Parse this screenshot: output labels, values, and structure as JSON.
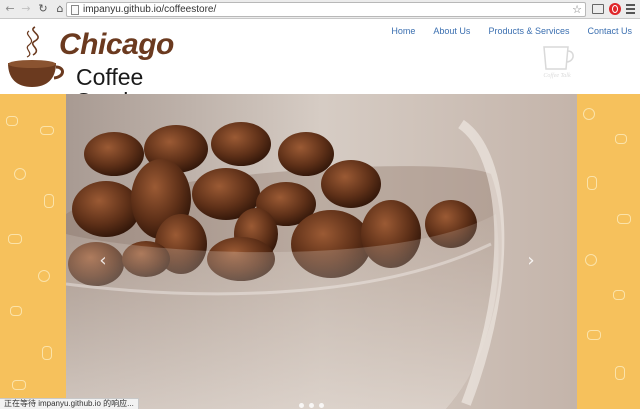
{
  "browser": {
    "url": "impanyu.github.io/coffeestore/",
    "icons": {
      "back": "arrow-left-icon",
      "forward": "arrow-right-icon",
      "reload": "reload-icon",
      "home": "home-icon",
      "bookmark": "star-icon",
      "cast": "cast-icon",
      "extension": "opera-icon",
      "menu": "hamburger-menu-icon"
    },
    "status_text": "正在等待 impanyu.github.io 的响应..."
  },
  "header": {
    "logo_title": "Chicago",
    "logo_subtitle": "Coffee Service",
    "nav": [
      "Home",
      "About Us",
      "Products & Services",
      "Contact Us"
    ],
    "badge_text": "Coffee Talk"
  },
  "carousel": {
    "slide_count": 3,
    "prev_icon": "chevron-left-icon",
    "next_icon": "chevron-right-icon"
  },
  "colors": {
    "brand_brown": "#6b3a1f",
    "nav_link": "#3b6fb0",
    "pattern_yellow": "#f6c15c"
  }
}
